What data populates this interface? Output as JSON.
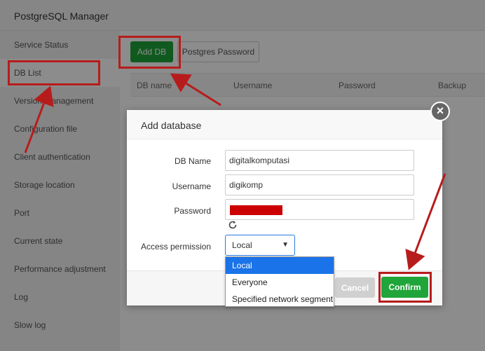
{
  "app": {
    "title": "PostgreSQL Manager"
  },
  "sidebar": {
    "items": [
      {
        "label": "Service Status"
      },
      {
        "label": "DB List"
      },
      {
        "label": "Version management"
      },
      {
        "label": "Configuration file"
      },
      {
        "label": "Client authentication"
      },
      {
        "label": "Storage location"
      },
      {
        "label": "Port"
      },
      {
        "label": "Current state"
      },
      {
        "label": "Performance adjustment"
      },
      {
        "label": "Log"
      },
      {
        "label": "Slow log"
      }
    ],
    "active_index": 1
  },
  "toolbar": {
    "add_db_label": "Add DB",
    "postgres_password_label": "Postgres Password"
  },
  "table": {
    "headers": [
      "DB name",
      "Username",
      "Password",
      "Backup"
    ]
  },
  "modal": {
    "title": "Add database",
    "close_glyph": "×",
    "fields": {
      "db_name": {
        "label": "DB Name",
        "value": "digitalkomputasi"
      },
      "username": {
        "label": "Username",
        "value": "digikomp"
      },
      "password": {
        "label": "Password",
        "value": ""
      },
      "access_permission": {
        "label": "Access permission",
        "value": "Local"
      }
    },
    "dropdown_options": [
      "Local",
      "Everyone",
      "Specified network segment"
    ],
    "cancel_label": "Cancel",
    "confirm_label": "Confirm"
  },
  "colors": {
    "accent_green": "#20a53a",
    "annotation_red": "#b71c1c",
    "dropdown_selected": "#1a73e8"
  },
  "icons": {
    "refresh": "refresh-icon",
    "close": "close-icon",
    "chevron": "chevron-down-icon"
  }
}
